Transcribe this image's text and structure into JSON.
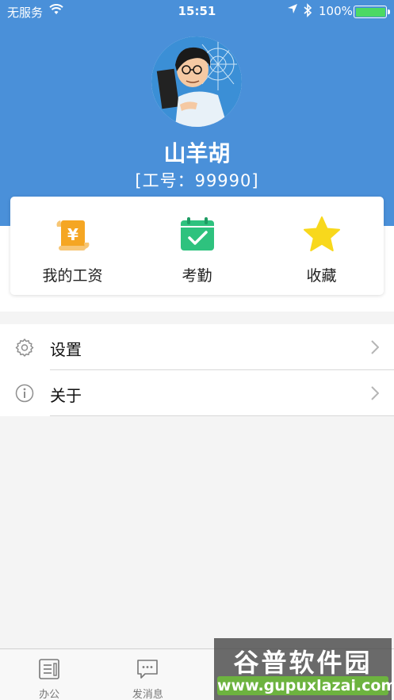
{
  "status_bar": {
    "carrier": "无服务",
    "time": "15:51",
    "battery_text": "100%",
    "battery_level": 1.0,
    "battery_color": "#4cd964"
  },
  "theme": {
    "header_color": "#4a90d9",
    "salary_icon_color": "#f5a623",
    "attendance_icon_color": "#2ec27e",
    "favorite_icon_color": "#f8d81c"
  },
  "profile": {
    "name": "山羊胡",
    "employee_id": "[工号：99990]",
    "avatar_icon": "avatar-cartoon-portrait"
  },
  "quick_actions": [
    {
      "label": "我的工资",
      "icon": "salary-scroll-icon"
    },
    {
      "label": "考勤",
      "icon": "calendar-check-icon"
    },
    {
      "label": "收藏",
      "icon": "star-icon"
    }
  ],
  "menu": [
    {
      "label": "设置",
      "icon": "gear-icon"
    },
    {
      "label": "关于",
      "icon": "info-icon"
    }
  ],
  "tab_bar": {
    "tabs": [
      {
        "label": "办公",
        "icon": "office-icon"
      },
      {
        "label": "发消息",
        "icon": "message-icon"
      },
      {
        "label": "",
        "icon": "obscured-tab-icon"
      },
      {
        "label": "",
        "icon": "obscured-tab-icon"
      }
    ]
  },
  "watermark": {
    "title": "谷普软件园",
    "url": "www.gupuxlazai.com"
  }
}
